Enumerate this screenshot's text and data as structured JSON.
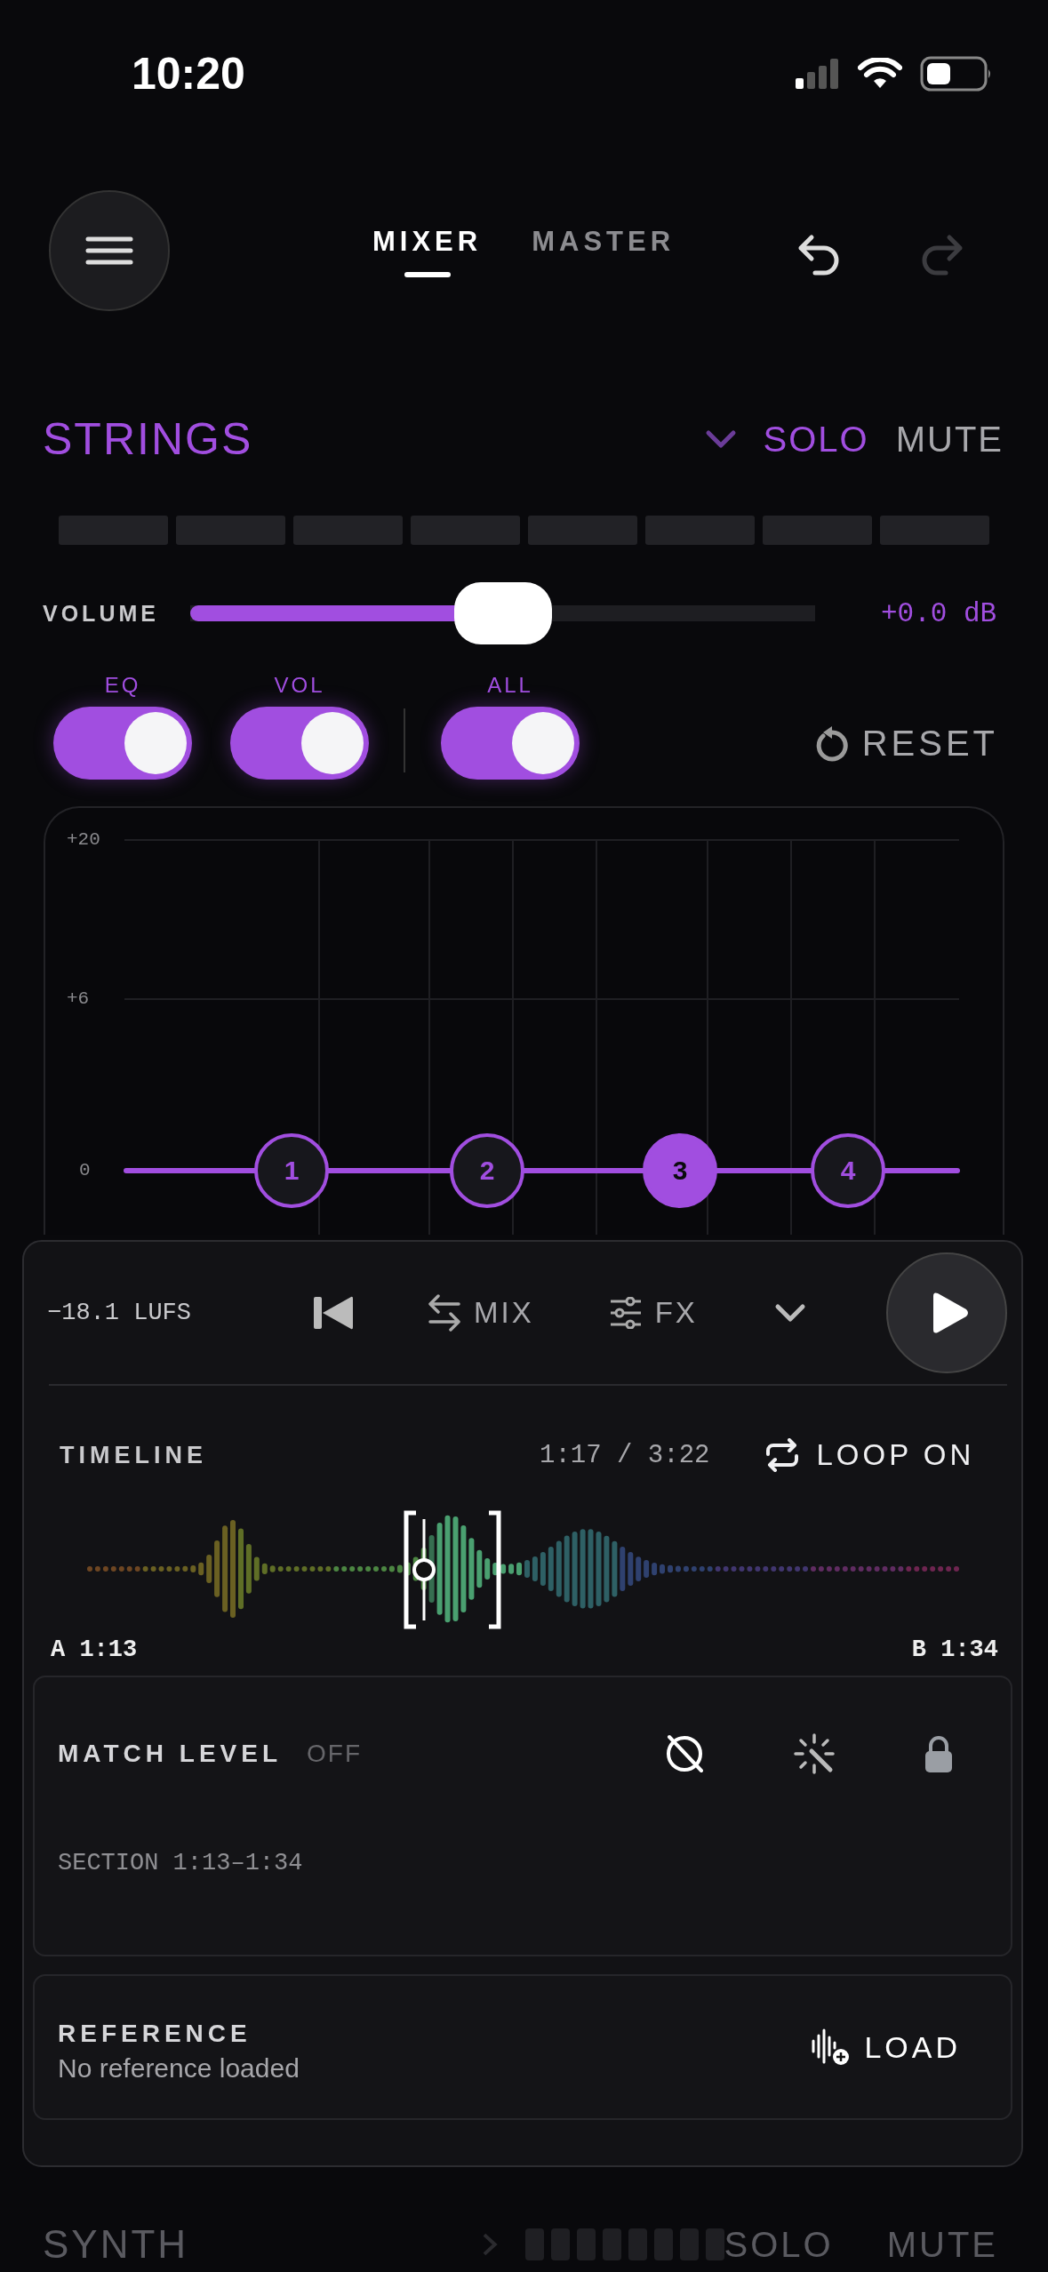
{
  "status_bar": {
    "time": "10:20"
  },
  "header": {
    "tabs": [
      {
        "label": "MIXER",
        "selected": true
      },
      {
        "label": "MASTER",
        "selected": false
      }
    ],
    "undo": {
      "disabled": false
    },
    "redo": {
      "disabled": true
    }
  },
  "track": {
    "name": "STRINGS",
    "solo": {
      "label": "SOLO",
      "on": true
    },
    "mute": {
      "label": "MUTE",
      "on": false
    },
    "volume": {
      "label": "VOLUME",
      "level": 0.5,
      "reading": "+0.0 dB"
    },
    "toggles": [
      {
        "label": "EQ",
        "on": true
      },
      {
        "label": "VOL",
        "on": true
      },
      {
        "label": "ALL",
        "on": true
      }
    ],
    "reset": "RESET"
  },
  "eq": {
    "y_labels": [
      "+20",
      "+6",
      "0"
    ],
    "bands": [
      {
        "label": "1",
        "selected": false
      },
      {
        "label": "2",
        "selected": false
      },
      {
        "label": "3",
        "selected": true
      },
      {
        "label": "4",
        "selected": false
      }
    ]
  },
  "transport": {
    "loudness": "−18.1 LUFS",
    "mix": "MIX",
    "fx": "FX"
  },
  "timeline": {
    "title": "TIMELINE",
    "position": "1:17 / 3:22",
    "loop": {
      "label": "LOOP ON",
      "on": true
    },
    "marker_a": "A 1:13",
    "marker_b": "B 1:34"
  },
  "match_level": {
    "title": "MATCH LEVEL",
    "state": "OFF",
    "section": "SECTION 1:13–1:34"
  },
  "reference": {
    "title": "REFERENCE",
    "status": "No reference loaded",
    "button": "LOAD"
  },
  "next_track": {
    "name": "SYNTH",
    "solo": "SOLO",
    "mute": "MUTE"
  }
}
